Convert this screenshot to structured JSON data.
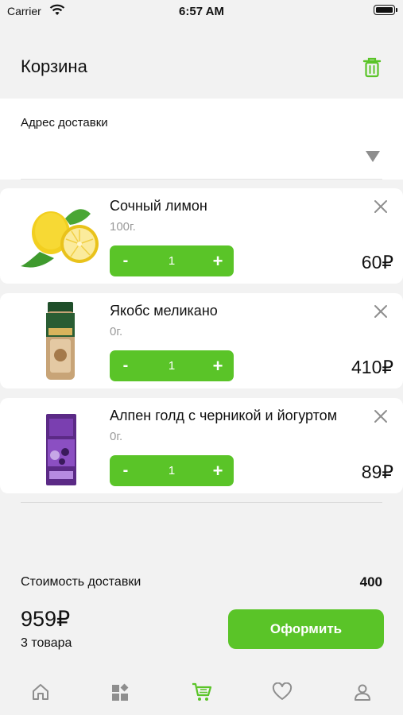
{
  "status_bar": {
    "carrier": "Carrier",
    "time": "6:57 AM"
  },
  "header": {
    "title": "Корзина",
    "trash_icon": "trash-icon"
  },
  "address": {
    "label": "Адрес доставки",
    "dropdown_icon": "dropdown-triangle-icon"
  },
  "cart_items": [
    {
      "name": "Сочный лимон",
      "weight": "100г.",
      "quantity": "1",
      "price": "60₽",
      "minus": "-",
      "plus": "+",
      "image": "lemon"
    },
    {
      "name": "Якобс меликано",
      "weight": "0г.",
      "quantity": "1",
      "price": "410₽",
      "minus": "-",
      "plus": "+",
      "image": "coffee-jar"
    },
    {
      "name": "Алпен голд с черникой и йогуртом",
      "weight": "0г.",
      "quantity": "1",
      "price": "89₽",
      "minus": "-",
      "plus": "+",
      "image": "chocolate-bar"
    }
  ],
  "summary": {
    "delivery_label": "Стоимость доставки",
    "delivery_value": "400",
    "total": "959₽",
    "items_count": "3 товара",
    "checkout_label": "Оформить"
  },
  "tab_bar": {
    "tabs": [
      {
        "name": "home",
        "icon": "home-icon",
        "active": false
      },
      {
        "name": "catalog",
        "icon": "catalog-icon",
        "active": false
      },
      {
        "name": "cart",
        "icon": "cart-icon",
        "active": true
      },
      {
        "name": "favorites",
        "icon": "heart-icon",
        "active": false
      },
      {
        "name": "profile",
        "icon": "user-icon",
        "active": false
      }
    ]
  },
  "colors": {
    "accent": "#5ac428",
    "background": "#f2f2f2",
    "card": "#ffffff",
    "muted_text": "#9a9a9a"
  }
}
